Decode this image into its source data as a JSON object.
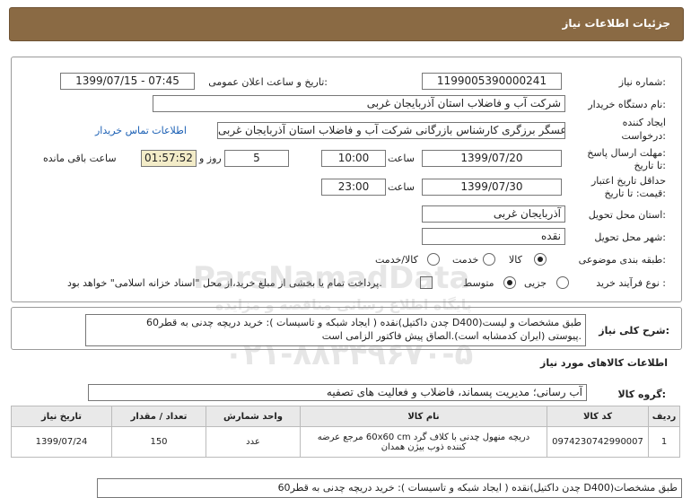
{
  "header": {
    "title": "جزئیات اطلاعات نیاز"
  },
  "fields": {
    "need_number_label": "شماره نیاز:",
    "need_number": "1199005390000241",
    "announce_label": "تاریخ و ساعت اعلان عمومی:",
    "announce_value": "1399/07/15 - 07:45",
    "buyer_label": "نام دستگاه خریدار:",
    "buyer_value": "شرکت آب و فاضلاب استان آذربایجان غربی",
    "creator_label_1": "ایجاد کننده",
    "creator_label_2": "درخواست:",
    "creator_value": "عسگر  برزگری کارشناس بازرگانی شرکت آب و فاضلاب استان آذربایجان غربی",
    "contact_link": "اطلاعات تماس خریدار",
    "reply_label_1": "مهلت ارسال پاسخ:",
    "reply_label_2": "تا تاریخ:",
    "reply_date": "1399/07/20",
    "time_label": "ساعت",
    "reply_time": "10:00",
    "days_value": "5",
    "days_label": "روز و",
    "remaining_time": "01:57:52",
    "remaining_label": "ساعت باقی مانده",
    "validity_label_1": "حداقل تاریخ اعتبار",
    "validity_label_2": "قیمت: تا تاریخ:",
    "validity_date": "1399/07/30",
    "validity_time": "23:00",
    "province_label": "استان محل تحویل:",
    "province_value": "آذربایجان غربی",
    "city_label": "شهر محل تحویل:",
    "city_value": "نقده",
    "category_label": "طبقه بندی موضوعی:",
    "cat_goods": "کالا",
    "cat_service": "خدمت",
    "cat_goods_service": "کالا/خدمت",
    "process_label": "نوع فرآیند خرید :",
    "proc_partial": "جزیی",
    "proc_medium": "متوسط",
    "payment_note": "پرداخت تمام یا بخشی از مبلغ خرید،از محل \"اسناد خزانه اسلامی\" خواهد بود."
  },
  "description": {
    "label": "شرح کلی نیاز:",
    "line1": "نقده ( ایجاد شبکه و تاسیسات ): خرید دریچه چدنی به قطر60(چدن داکتیل D400)طبق مشخصات و لیست",
    "line2": "پیوستی (ایران کدمشابه است).الصاق پیش فاکتور الزامی است."
  },
  "goods_section": {
    "title": "اطلاعات کالاهای مورد نیاز",
    "group_label": "گروه کالا:",
    "group_value": "آب رسانی؛ مدیریت پسماند، فاضلاب و فعالیت های تصفیه"
  },
  "table": {
    "headers": [
      "ردیف",
      "کد کالا",
      "نام کالا",
      "واحد شمارش",
      "تعداد / مقدار",
      "تاریخ نیاز"
    ],
    "rows": [
      {
        "row": "1",
        "code": "0974230742990007",
        "name_1": "دریچه منهول چدنی با کلاف گرد 60x60 cm مرجع عرضه",
        "name_2": "کننده ذوب بیژن همدان",
        "unit": "عدد",
        "qty": "150",
        "date": "1399/07/24"
      }
    ]
  },
  "bottom_note": "نقده ( ایجاد شبکه و تاسیسات ): خرید دریچه چدنی به قطر60(چدن داکتیل D400)طبق مشخصات",
  "watermark": {
    "line1": "ParsNamadData",
    "line2": "پایگاه اطلاع رسانی مناقصه و مزایده",
    "line3": "۰۲۱-۸۸۳۴۹۶۷۰-۵"
  }
}
